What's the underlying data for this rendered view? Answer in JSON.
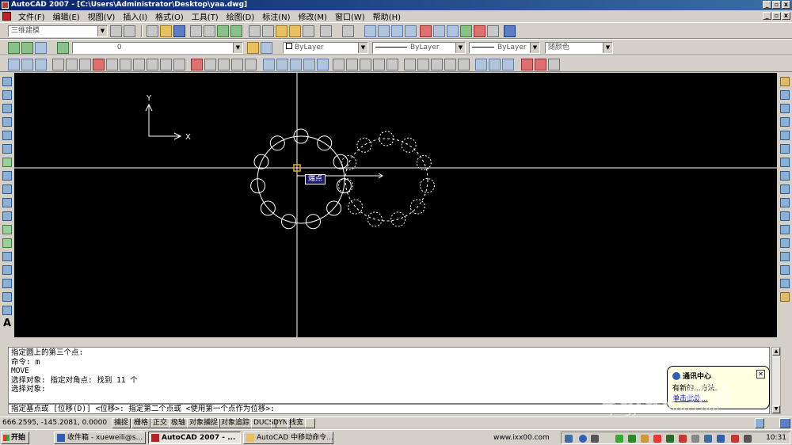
{
  "window": {
    "title": "AutoCAD 2007 - [C:\\Users\\Administrator\\Desktop\\yaa.dwg]"
  },
  "menu": [
    "文件(F)",
    "编辑(E)",
    "视图(V)",
    "插入(I)",
    "格式(O)",
    "工具(T)",
    "绘图(D)",
    "标注(N)",
    "修改(M)",
    "窗口(W)",
    "帮助(H)"
  ],
  "toolbars": {
    "workspace": "三维建模",
    "layer": "0",
    "color": "ByLayer",
    "linetype": "ByLayer",
    "lineweight": "ByLayer",
    "plotstyle": "随颜色"
  },
  "canvas": {
    "bg_color": "#000000",
    "ucs_x": "X",
    "ucs_y": "Y",
    "snap_tooltip": "端点"
  },
  "command": {
    "history": [
      "指定圆上的第三个点:",
      "命令: m",
      "MOVE",
      "选择对象: 指定对角点: 找到 11 个",
      "选择对象:"
    ],
    "prompt": "指定基点或 [位移(D)] <位移>:  指定第二个点或 <使用第一个点作为位移>:"
  },
  "notification": {
    "title": "通讯中心",
    "body": "有新的...方法。",
    "link": "单击此处..."
  },
  "status": {
    "coords": "666.2595,  -145.2081, 0.0000",
    "buttons": [
      "捕捉",
      "栅格",
      "正交",
      "极轴",
      "对象捕捉",
      "对象追踪",
      "DUCS",
      "DYN",
      "线宽"
    ]
  },
  "taskbar": {
    "start": "开始",
    "tasks": [
      "收件箱 - xueweili@s...",
      "AutoCAD 2007 - ...",
      "AutoCAD 中移动命令..."
    ],
    "url": "www.ixx00.com",
    "clock": "10:31"
  },
  "watermark": {
    "line1": "Baidu 经验",
    "line2": "jingyan.baidu.com"
  }
}
